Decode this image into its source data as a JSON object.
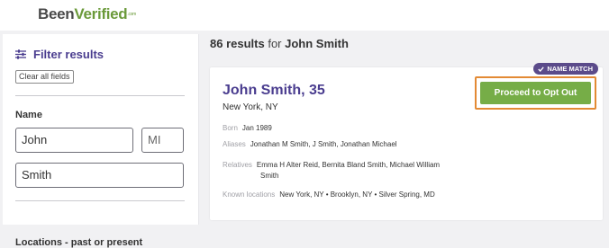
{
  "header": {
    "logo_part1": "Been",
    "logo_part2": "Verified",
    "logo_suffix": ".com"
  },
  "sidebar": {
    "filter_title": "Filter results",
    "filter_icon": "sliders-icon",
    "clear_label": "Clear all fields",
    "name_label": "Name",
    "first_name_value": "John",
    "middle_initial_placeholder": "MI",
    "last_name_value": "Smith",
    "location_label": "Locations - past or present"
  },
  "results": {
    "count": "86 results",
    "for_text": "for",
    "query": "John Smith"
  },
  "card": {
    "badge_label": "NAME MATCH",
    "badge_icon": "check-icon",
    "name": "John Smith, 35",
    "location": "New York, NY",
    "born_label": "Born",
    "born_value": "Jan 1989",
    "aliases_label": "Aliases",
    "aliases_value": "Jonathan M Smith, J Smith, Jonathan Michael",
    "relatives_label": "Relatives",
    "relatives_line1": "Emma H Alter Reid, Bernita Bland Smith, Michael William",
    "relatives_line2": "Smith",
    "known_locations_label": "Known locations",
    "known_locations_value": "New York, NY • Brooklyn, NY • Silver Spring, MD",
    "optout_label": "Proceed to Opt Out"
  },
  "colors": {
    "brand_purple": "#4a3d8f",
    "brand_green": "#6b9a3a",
    "button_green": "#76ad47",
    "highlight_orange": "#e38a34",
    "badge_purple": "#5b4b8a"
  }
}
